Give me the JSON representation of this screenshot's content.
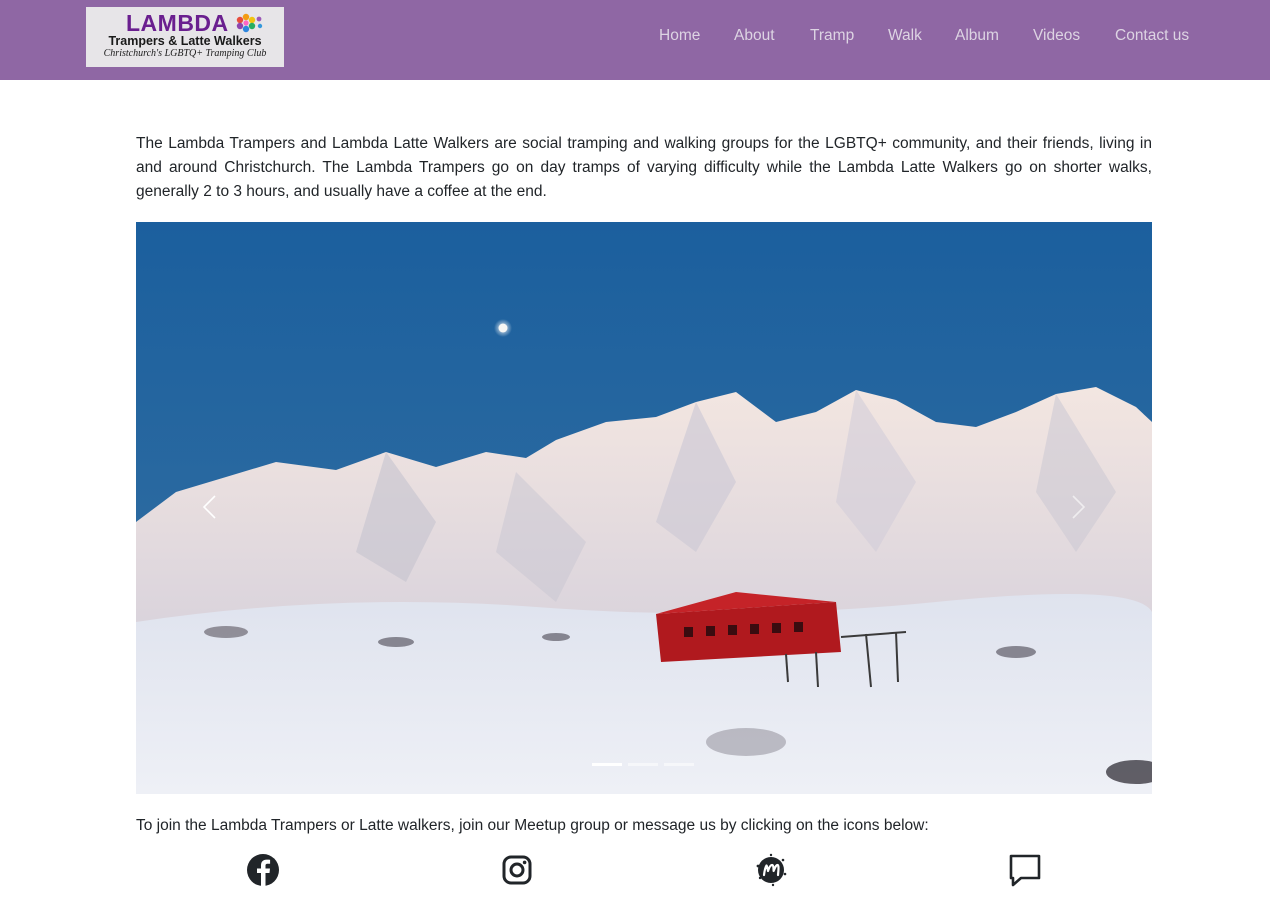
{
  "header": {
    "logo": {
      "title": "LAMBDA",
      "subtitle": "Trampers & Latte Walkers",
      "tagline": "Christchurch's LGBTQ+ Tramping Club"
    },
    "nav": [
      {
        "label": "Home"
      },
      {
        "label": "About"
      },
      {
        "label": "Tramp"
      },
      {
        "label": "Walk"
      },
      {
        "label": "Album"
      },
      {
        "label": "Videos"
      },
      {
        "label": "Contact us"
      }
    ],
    "nav_color": "#8f67a4"
  },
  "main": {
    "intro": "The Lambda Trampers and Lambda Latte Walkers are social tramping and walking groups for the LGBTQ+ community, and their friends, living in and around Christchurch. The Lambda Trampers go on day tramps of varying difficulty while the Lambda Latte Walkers go on shorter walks, generally 2 to 3 hours, and usually have a coffee at the end.",
    "carousel": {
      "slide_count": 3,
      "active_slide": 1,
      "prev_icon": "chevron-left-icon",
      "next_icon": "chevron-right-icon"
    },
    "join_text": "To join the Lambda Trampers or Latte walkers, join our Meetup group or message us by clicking on the icons below:",
    "social": [
      {
        "icon": "facebook-icon"
      },
      {
        "icon": "instagram-icon"
      },
      {
        "icon": "meetup-icon"
      },
      {
        "icon": "message-icon"
      }
    ]
  }
}
